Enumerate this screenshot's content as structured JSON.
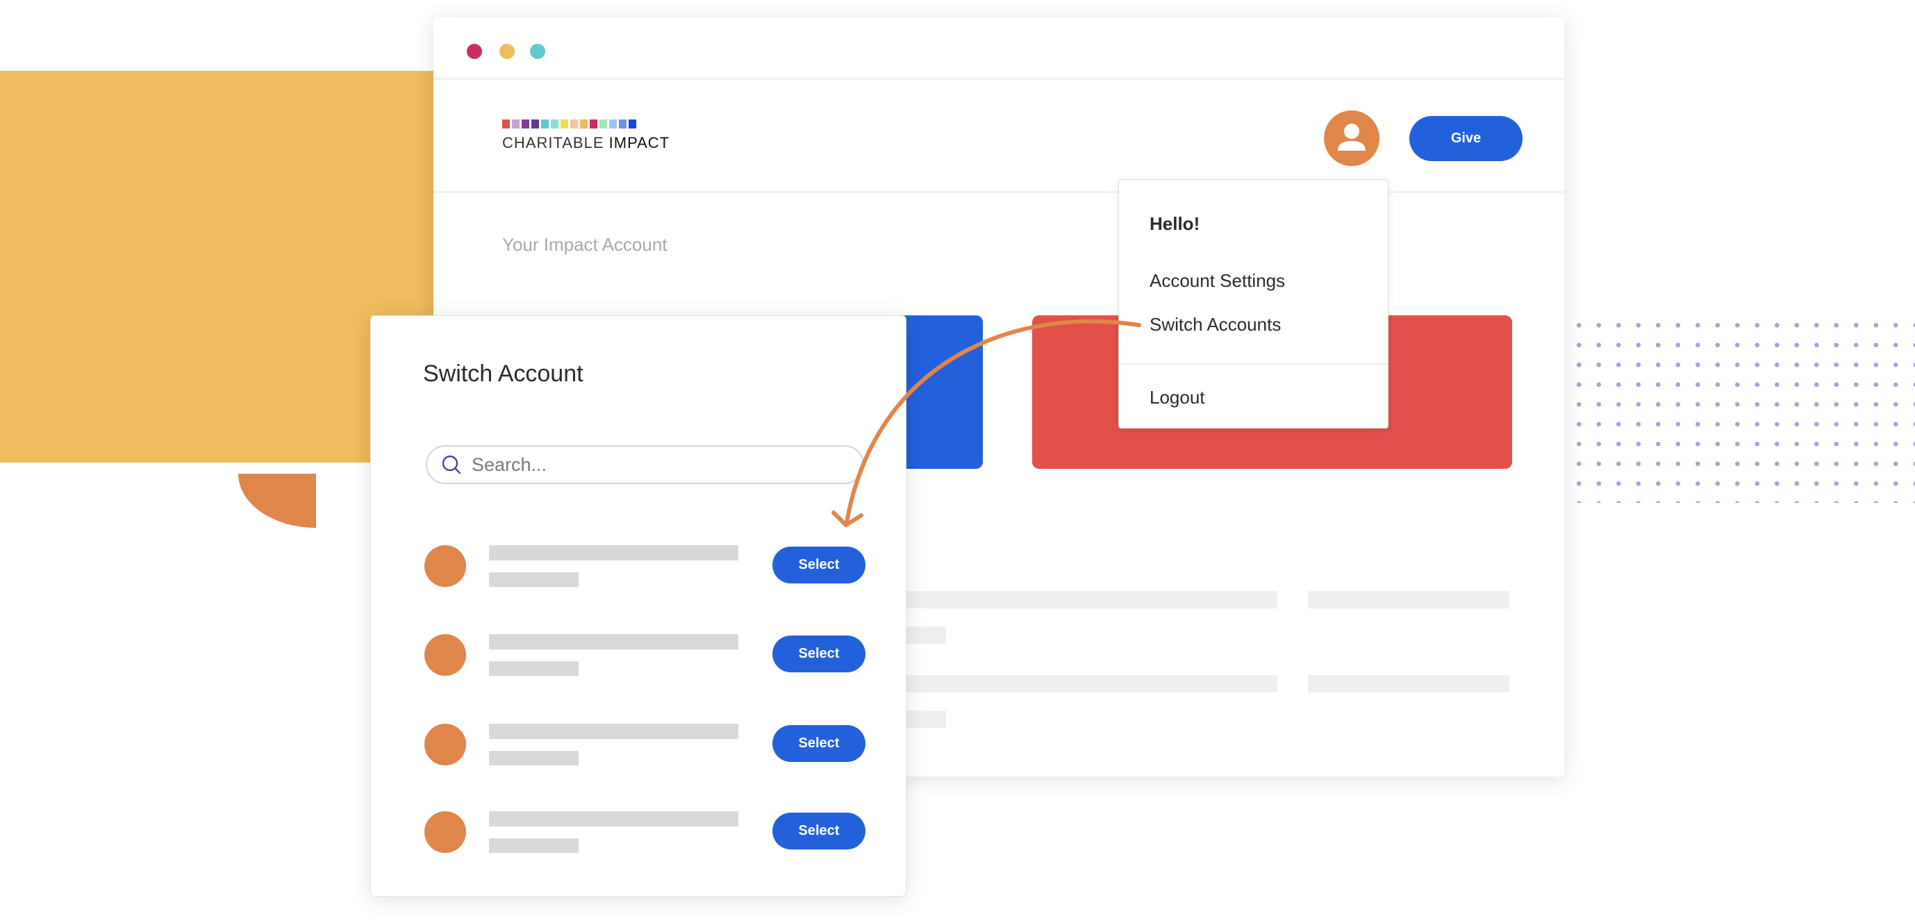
{
  "window": {
    "controls": [
      {
        "name": "close",
        "color": "#cc2e62"
      },
      {
        "name": "minimize",
        "color": "#eebb5e"
      },
      {
        "name": "maximize",
        "color": "#62c9cf"
      }
    ]
  },
  "header": {
    "logo_colors": [
      "#e1504a",
      "#c9a0d8",
      "#7f3f98",
      "#5c3d8f",
      "#5fc9cf",
      "#8de0d8",
      "#f6dc4b",
      "#f3c6a3",
      "#eebb5e",
      "#cc2e62",
      "#a8e4b6",
      "#9fc3f0",
      "#6f92e0",
      "#1746e0"
    ],
    "logo_text_light": "CHARITABLE",
    "logo_text_bold": "IMPACT",
    "give_label": "Give"
  },
  "main": {
    "title": "Your Impact Account"
  },
  "user_menu": {
    "greeting": "Hello!",
    "items": [
      "Account Settings",
      "Switch Accounts",
      "Logout"
    ]
  },
  "switch_modal": {
    "title": "Switch Account",
    "search_placeholder": "Search...",
    "select_label": "Select",
    "row_count_labels": [
      "Select",
      "Select",
      "Select",
      "Select"
    ]
  },
  "colors": {
    "accent_blue": "#2361dc",
    "accent_orange": "#e0864a",
    "red": "#e1504a",
    "yellow": "#eebb5e"
  }
}
